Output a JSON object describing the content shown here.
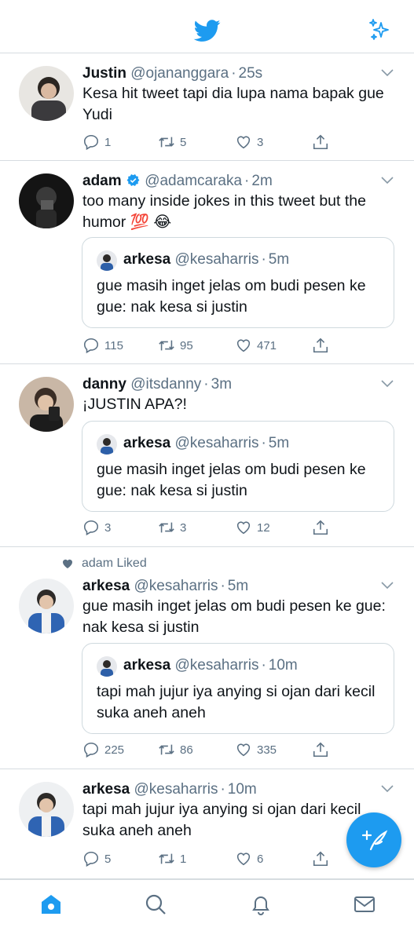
{
  "colors": {
    "brand": "#1d9bf0",
    "muted": "#5b7083",
    "divider": "#d6dce0",
    "verified": "#1d9bf0"
  },
  "header": {
    "logo_icon": "twitter-bird-icon",
    "sparkle_icon": "sparkle-icon"
  },
  "tweets": [
    {
      "name": "Justin",
      "handle": "@ojananggara",
      "time": "25s",
      "text": "Kesa hit tweet tapi dia lupa nama bapak gue Yudi",
      "replies": "1",
      "retweets": "5",
      "likes": "3"
    },
    {
      "name": "adam",
      "verified": true,
      "handle": "@adamcaraka",
      "time": "2m",
      "text": "too many inside jokes in this tweet but the humor 💯 😂",
      "quote": {
        "name": "arkesa",
        "handle": "@kesaharris",
        "time": "5m",
        "text": "gue masih inget jelas om budi pesen ke gue: nak kesa si justin"
      },
      "replies": "115",
      "retweets": "95",
      "likes": "471"
    },
    {
      "name": "danny",
      "handle": "@itsdanny",
      "time": "3m",
      "text": "¡JUSTIN APA?!",
      "quote": {
        "name": "arkesa",
        "handle": "@kesaharris",
        "time": "5m",
        "text": "gue masih inget jelas om budi pesen ke gue: nak kesa si justin"
      },
      "replies": "3",
      "retweets": "3",
      "likes": "12"
    },
    {
      "liked_by": "adam Liked",
      "name": "arkesa",
      "handle": "@kesaharris",
      "time": "5m",
      "text": "gue masih inget jelas om budi pesen ke gue: nak kesa si justin",
      "quote": {
        "name": "arkesa",
        "handle": "@kesaharris",
        "time": "10m",
        "text": "tapi mah jujur iya anying si ojan dari kecil suka aneh aneh"
      },
      "replies": "225",
      "retweets": "86",
      "likes": "335"
    },
    {
      "name": "arkesa",
      "handle": "@kesaharris",
      "time": "10m",
      "text": "tapi mah jujur iya anying si ojan dari kecil suka aneh aneh",
      "replies": "5",
      "retweets": "1",
      "likes": "6"
    }
  ],
  "tabbar": {
    "home_icon": "home-icon",
    "search_icon": "search-icon",
    "notifications_icon": "bell-icon",
    "messages_icon": "mail-icon"
  },
  "fab": {
    "icon": "compose-tweet-icon"
  }
}
